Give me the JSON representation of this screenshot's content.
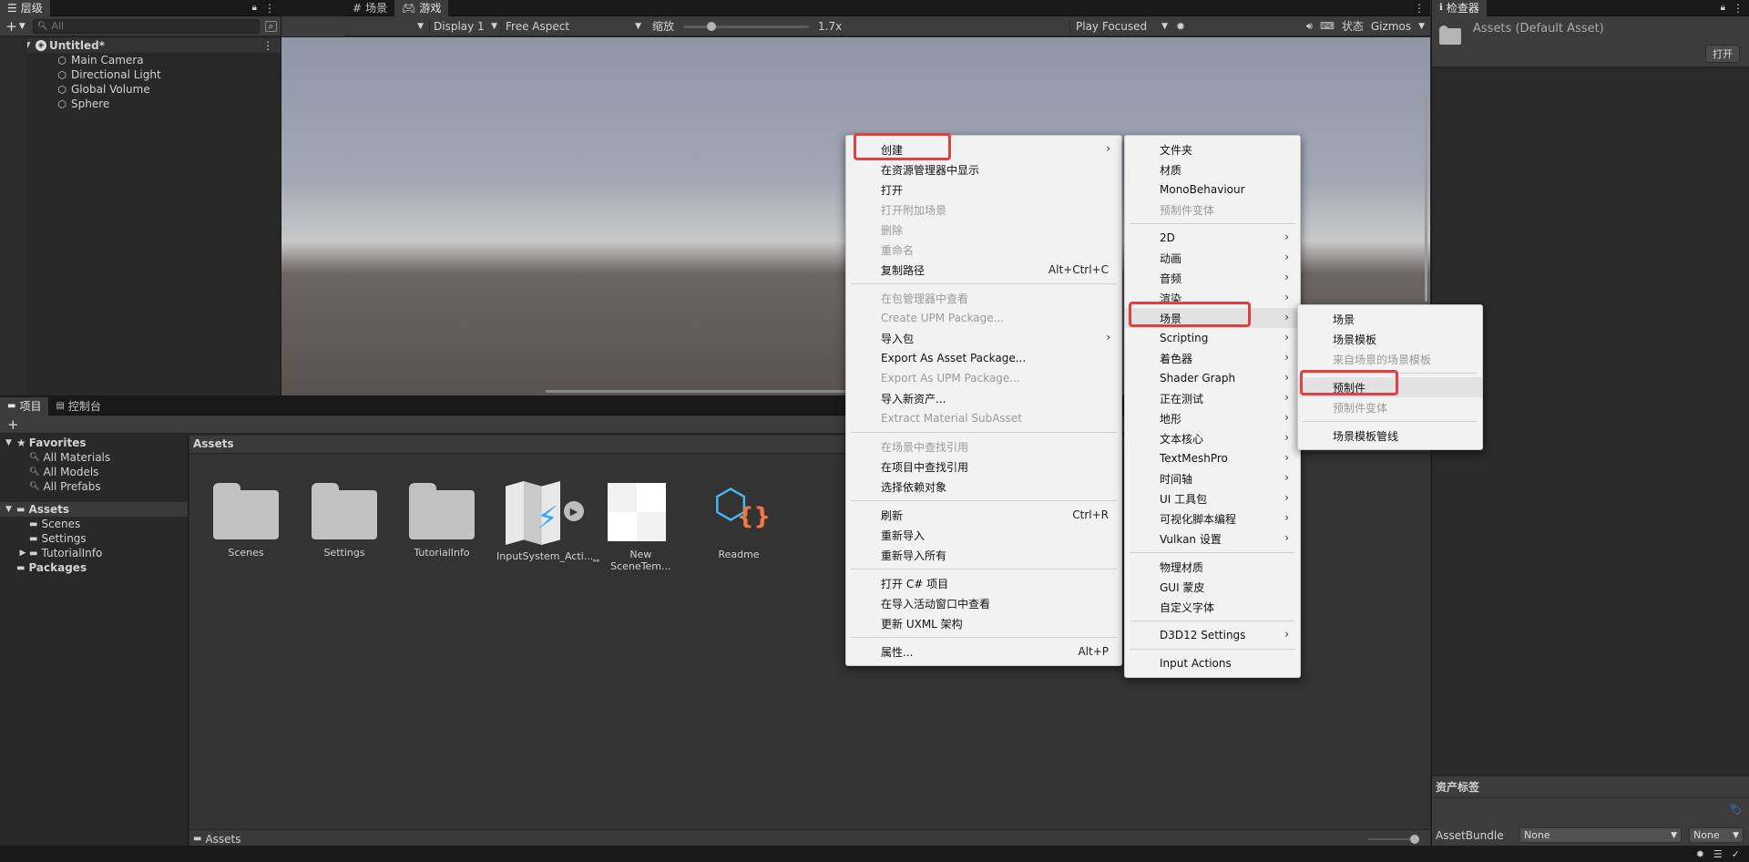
{
  "hierarchy": {
    "tab_label": "层级",
    "search_placeholder": "All",
    "scene_name": "Untitled*",
    "items": [
      "Main Camera",
      "Directional Light",
      "Global Volume",
      "Sphere"
    ]
  },
  "scene_tabs": {
    "scene": "场景",
    "game": "游戏"
  },
  "game_toolbar": {
    "display": "Display 1",
    "aspect": "Free Aspect",
    "scale_label": "缩放",
    "scale_value": "1.7x",
    "scale_fraction": 0.2,
    "play_mode": "Play Focused",
    "stats": "状态",
    "gizmos": "Gizmos"
  },
  "inspector": {
    "tab_label": "检查器",
    "asset_title": "Assets (Default Asset)",
    "open_button": "打开",
    "labels_header": "资产标签",
    "assetbundle_label": "AssetBundle",
    "assetbundle_value": "None",
    "variant_value": "None"
  },
  "project": {
    "tab_project": "项目",
    "tab_console": "控制台",
    "favorites": {
      "label": "Favorites",
      "items": [
        "All Materials",
        "All Models",
        "All Prefabs"
      ]
    },
    "assets_root": "Assets",
    "asset_folders": [
      "Scenes",
      "Settings",
      "TutorialInfo"
    ],
    "packages": "Packages",
    "breadcrumb": "Assets",
    "footer_path": "Assets",
    "grid": [
      "Scenes",
      "Settings",
      "TutorialInfo",
      "InputSystem_Acti...",
      "New SceneTem...",
      "Readme"
    ]
  },
  "context_menu": {
    "items": [
      {
        "label": "创建",
        "submenu": true
      },
      {
        "label": "在资源管理器中显示"
      },
      {
        "label": "打开"
      },
      {
        "label": "打开附加场景",
        "disabled": true
      },
      {
        "label": "删除",
        "disabled": true
      },
      {
        "label": "重命名",
        "disabled": true
      },
      {
        "label": "复制路径",
        "shortcut": "Alt+Ctrl+C"
      },
      {
        "sep": true
      },
      {
        "label": "在包管理器中查看",
        "disabled": true
      },
      {
        "label": "Create UPM Package...",
        "disabled": true
      },
      {
        "label": "导入包",
        "submenu": true
      },
      {
        "label": "Export As Asset Package..."
      },
      {
        "label": "Export As UPM Package...",
        "disabled": true
      },
      {
        "label": "导入新资产..."
      },
      {
        "label": "Extract Material SubAsset",
        "disabled": true
      },
      {
        "sep": true
      },
      {
        "label": "在场景中查找引用",
        "disabled": true
      },
      {
        "label": "在项目中查找引用"
      },
      {
        "label": "选择依赖对象"
      },
      {
        "sep": true
      },
      {
        "label": "刷新",
        "shortcut": "Ctrl+R"
      },
      {
        "label": "重新导入"
      },
      {
        "label": "重新导入所有"
      },
      {
        "sep": true
      },
      {
        "label": "打开 C# 项目"
      },
      {
        "label": "在导入活动窗口中查看"
      },
      {
        "label": "更新 UXML 架构"
      },
      {
        "sep": true
      },
      {
        "label": "属性...",
        "shortcut": "Alt+P"
      }
    ]
  },
  "create_menu": {
    "items": [
      {
        "label": "文件夹"
      },
      {
        "label": "材质"
      },
      {
        "label": "MonoBehaviour"
      },
      {
        "label": "预制件变体",
        "disabled": true
      },
      {
        "sep": true
      },
      {
        "label": "2D",
        "submenu": true
      },
      {
        "label": "动画",
        "submenu": true
      },
      {
        "label": "音频",
        "submenu": true
      },
      {
        "label": "渲染",
        "submenu": true
      },
      {
        "label": "场景",
        "submenu": true,
        "highlight": true
      },
      {
        "label": "Scripting",
        "submenu": true
      },
      {
        "label": "着色器",
        "submenu": true
      },
      {
        "label": "Shader Graph",
        "submenu": true
      },
      {
        "label": "正在测试",
        "submenu": true
      },
      {
        "label": "地形",
        "submenu": true
      },
      {
        "label": "文本核心",
        "submenu": true
      },
      {
        "label": "TextMeshPro",
        "submenu": true
      },
      {
        "label": "时间轴",
        "submenu": true
      },
      {
        "label": "UI 工具包",
        "submenu": true
      },
      {
        "label": "可视化脚本编程",
        "submenu": true
      },
      {
        "label": "Vulkan 设置",
        "submenu": true
      },
      {
        "sep": true
      },
      {
        "label": "物理材质"
      },
      {
        "label": "GUI 蒙皮"
      },
      {
        "label": "自定义字体"
      },
      {
        "sep": true
      },
      {
        "label": "D3D12 Settings",
        "submenu": true
      },
      {
        "sep": true
      },
      {
        "label": "Input Actions"
      }
    ]
  },
  "scene_menu": {
    "items": [
      {
        "label": "场景"
      },
      {
        "label": "场景模板"
      },
      {
        "label": "来自场景的场景模板",
        "disabled": true
      },
      {
        "sep": true
      },
      {
        "label": "预制件",
        "highlight": true
      },
      {
        "label": "预制件变体",
        "disabled": true
      },
      {
        "sep": true
      },
      {
        "label": "场景模板管线"
      }
    ]
  },
  "colors": {
    "highlight_box": "#e24040",
    "panel_bg": "#282828",
    "toolbar_bg": "#3c3c3c"
  }
}
